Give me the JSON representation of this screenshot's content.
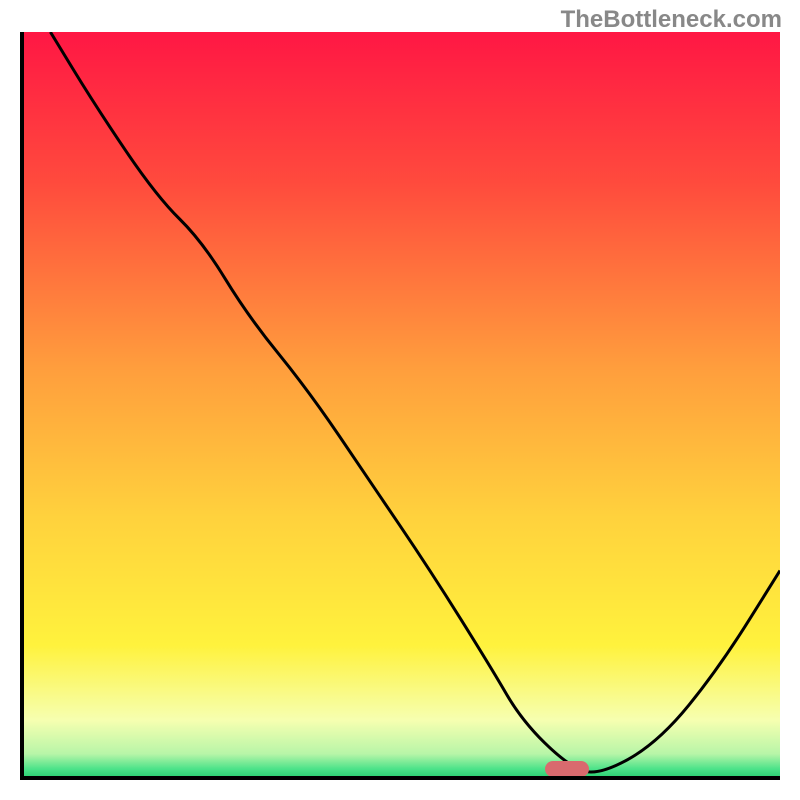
{
  "watermark": "TheBottleneck.com",
  "chart_data": {
    "type": "line",
    "title": "",
    "xlabel": "",
    "ylabel": "",
    "xlim": [
      0,
      100
    ],
    "ylim": [
      0,
      100
    ],
    "x": [
      4,
      10,
      18,
      24,
      30,
      38,
      46,
      54,
      62,
      66,
      72,
      76,
      84,
      92,
      100
    ],
    "values": [
      100,
      90,
      78,
      72,
      62,
      52,
      40,
      28,
      15,
      8,
      2,
      0.5,
      5,
      15,
      28
    ],
    "marker": {
      "x": 72,
      "y": 1.5
    },
    "gradient_stops": [
      {
        "offset": 0,
        "color": "#ff1744"
      },
      {
        "offset": 0.2,
        "color": "#ff4a3d"
      },
      {
        "offset": 0.45,
        "color": "#ff9e3d"
      },
      {
        "offset": 0.65,
        "color": "#ffd23d"
      },
      {
        "offset": 0.82,
        "color": "#fff23d"
      },
      {
        "offset": 0.92,
        "color": "#f6ffb0"
      },
      {
        "offset": 0.965,
        "color": "#b8f5a8"
      },
      {
        "offset": 0.985,
        "color": "#4de38a"
      },
      {
        "offset": 1.0,
        "color": "#1fc96a"
      }
    ]
  }
}
